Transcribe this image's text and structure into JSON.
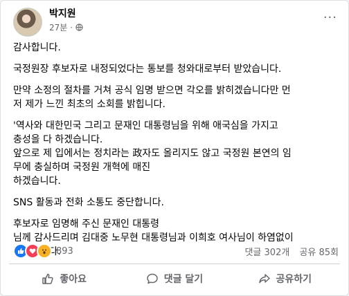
{
  "post": {
    "author": "박지원",
    "time": "27분 ·",
    "paragraphs": [
      "감사합니다.",
      "국정원장 후보자로 내정되었다는 통보를 청와대로부터 받았습니다.",
      "만약 소정의 절차를 거쳐 공식 임명 받으면 각오를 밝히겠습니다만 먼\n저 제가 느낀 최초의 소회를 밝힙니다.",
      "'역사와 대한민국 그리고 문재인 대통령님을 위해 애국심을 가지고\n충성을 다 하겠습니다.\n앞으로 제 입에서는 정치라는 政자도 올리지도 않고 국정원 본연의 임\n무에 충실하며 국정원 개혁에 매진\n하겠습니다.",
      "SNS 활동과 전화 소통도 중단합니다.",
      "후보자로 임명해 주신 문재인 대통령\n님께 감사드리며  김대중 노무현 대통령님과 이희호 여사님이 하염없이\n떠오릅니다."
    ]
  },
  "stats": {
    "reaction_count": "893",
    "comments": "댓글 302개",
    "shares": "공유 85회"
  },
  "actions": {
    "like": "좋아요",
    "comment": "댓글 달기",
    "share": "공유하기"
  },
  "colors": {
    "like_blue": "#1877f2",
    "love_red": "#f33e58",
    "wow_yellow": "#f7b125"
  }
}
